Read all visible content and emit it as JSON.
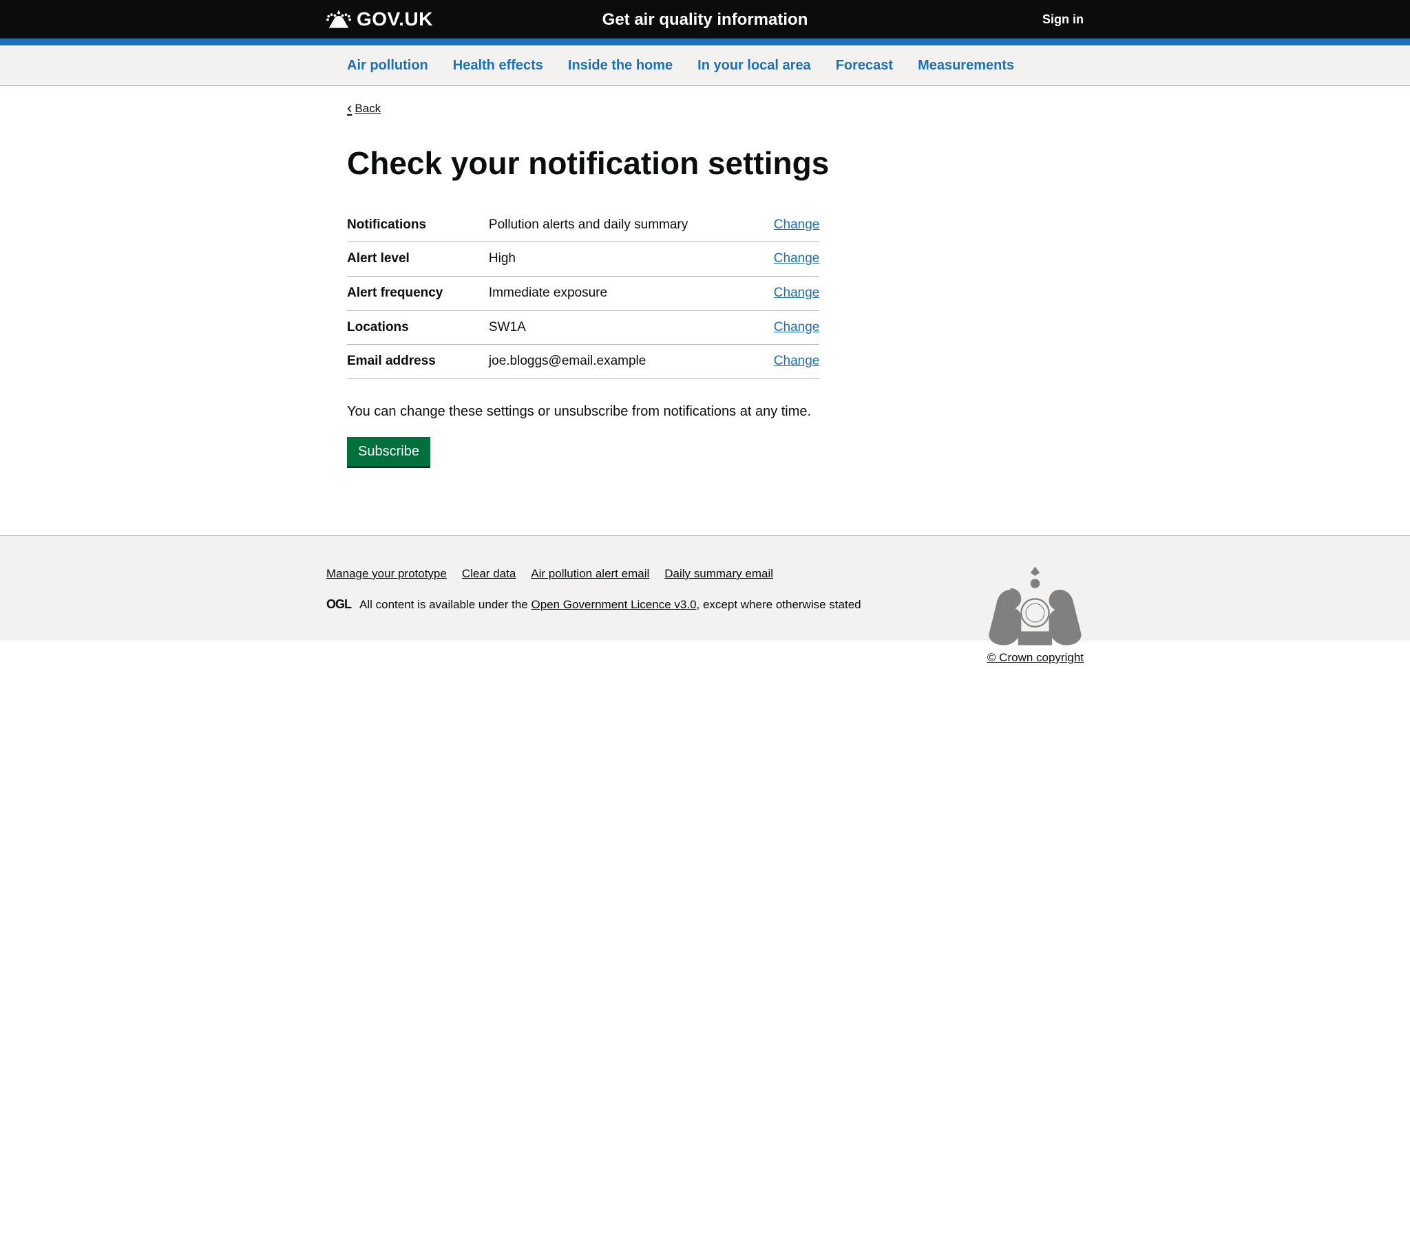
{
  "header": {
    "logo_text": "GOV.UK",
    "service_name": "Get air quality information",
    "sign_in": "Sign in"
  },
  "nav": {
    "items": [
      "Air pollution",
      "Health effects",
      "Inside the home",
      "In your local area",
      "Forecast",
      "Measurements"
    ]
  },
  "back_label": "Back",
  "page_title": "Check your notification settings",
  "summary": {
    "change_label": "Change",
    "rows": [
      {
        "key": "Notifications",
        "value": "Pollution alerts and daily summary"
      },
      {
        "key": "Alert level",
        "value": "High"
      },
      {
        "key": "Alert frequency",
        "value": "Immediate exposure"
      },
      {
        "key": "Locations",
        "value": "SW1A"
      },
      {
        "key": "Email address",
        "value": "joe.bloggs@email.example"
      }
    ]
  },
  "hint_text": "You can change these settings or unsubscribe from notifications at any time.",
  "subscribe_label": "Subscribe",
  "footer": {
    "links": [
      "Manage your prototype",
      "Clear data",
      "Air pollution alert email",
      "Daily summary email"
    ],
    "ogl_label": "OGL",
    "licence_prefix": "All content is available under the ",
    "licence_link": "Open Government Licence v3.0",
    "licence_suffix": ", except where otherwise stated",
    "copyright": "© Crown copyright"
  }
}
